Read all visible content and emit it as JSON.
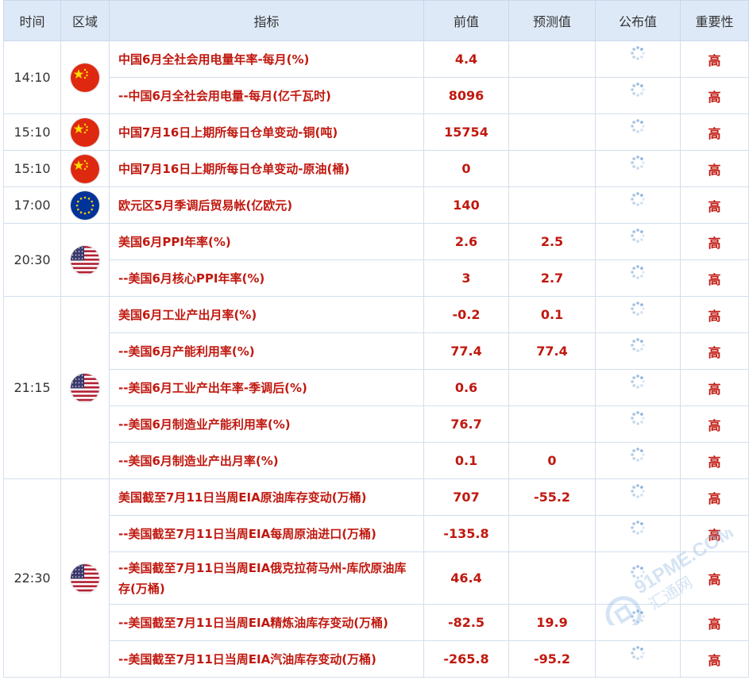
{
  "headers": {
    "time": "时间",
    "region": "区域",
    "indicator": "指标",
    "previous": "前值",
    "forecast": "预测值",
    "actual": "公布值",
    "importance": "重要性"
  },
  "groups": [
    {
      "time": "14:10",
      "flag": "china-flag-icon",
      "rows": [
        {
          "indicator": "中国6月全社会用电量年率-每月(%)",
          "previous": "4.4",
          "forecast": "",
          "importance": "高"
        },
        {
          "indicator": "--中国6月全社会用电量-每月(亿千瓦时)",
          "previous": "8096",
          "forecast": "",
          "importance": "高"
        }
      ]
    },
    {
      "time": "15:10",
      "flag": "china-flag-icon",
      "rows": [
        {
          "indicator": "中国7月16日上期所每日仓单变动-铜(吨)",
          "previous": "15754",
          "forecast": "",
          "importance": "高"
        }
      ]
    },
    {
      "time": "15:10",
      "flag": "china-flag-icon",
      "rows": [
        {
          "indicator": "中国7月16日上期所每日仓单变动-原油(桶)",
          "previous": "0",
          "forecast": "",
          "importance": "高"
        }
      ]
    },
    {
      "time": "17:00",
      "flag": "eu-flag-icon",
      "rows": [
        {
          "indicator": "欧元区5月季调后贸易帐(亿欧元)",
          "previous": "140",
          "forecast": "",
          "importance": "高"
        }
      ]
    },
    {
      "time": "20:30",
      "flag": "us-flag-icon",
      "rows": [
        {
          "indicator": "美国6月PPI年率(%)",
          "previous": "2.6",
          "forecast": "2.5",
          "importance": "高"
        },
        {
          "indicator": "--美国6月核心PPI年率(%)",
          "previous": "3",
          "forecast": "2.7",
          "importance": "高"
        }
      ]
    },
    {
      "time": "21:15",
      "flag": "us-flag-icon",
      "rows": [
        {
          "indicator": "美国6月工业产出月率(%)",
          "previous": "-0.2",
          "forecast": "0.1",
          "importance": "高"
        },
        {
          "indicator": "--美国6月产能利用率(%)",
          "previous": "77.4",
          "forecast": "77.4",
          "importance": "高"
        },
        {
          "indicator": "--美国6月工业产出年率-季调后(%)",
          "previous": "0.6",
          "forecast": "",
          "importance": "高"
        },
        {
          "indicator": "--美国6月制造业产能利用率(%)",
          "previous": "76.7",
          "forecast": "",
          "importance": "高"
        },
        {
          "indicator": "--美国6月制造业产出月率(%)",
          "previous": "0.1",
          "forecast": "0",
          "importance": "高"
        }
      ]
    },
    {
      "time": "22:30",
      "flag": "us-flag-icon",
      "rows": [
        {
          "indicator": "美国截至7月11日当周EIA原油库存变动(万桶)",
          "previous": "707",
          "forecast": "-55.2",
          "importance": "高"
        },
        {
          "indicator": "--美国截至7月11日当周EIA每周原油进口(万桶)",
          "previous": "-135.8",
          "forecast": "",
          "importance": "高"
        },
        {
          "indicator": "--美国截至7月11日当周EIA俄克拉荷马州-库欣原油库存(万桶)",
          "previous": "46.4",
          "forecast": "",
          "importance": "高",
          "tall": true
        },
        {
          "indicator": "--美国截至7月11日当周EIA精炼油库存变动(万桶)",
          "previous": "-82.5",
          "forecast": "19.9",
          "importance": "高"
        },
        {
          "indicator": "--美国截至7月11日当周EIA汽油库存变动(万桶)",
          "previous": "-265.8",
          "forecast": "-95.2",
          "importance": "高"
        }
      ]
    }
  ],
  "watermark": {
    "text": "91PME.COM",
    "subtext": "汇通网"
  },
  "colors": {
    "header_bg": "#dde9f7",
    "accent_red": "#c0180f",
    "border": "#d3deec"
  }
}
